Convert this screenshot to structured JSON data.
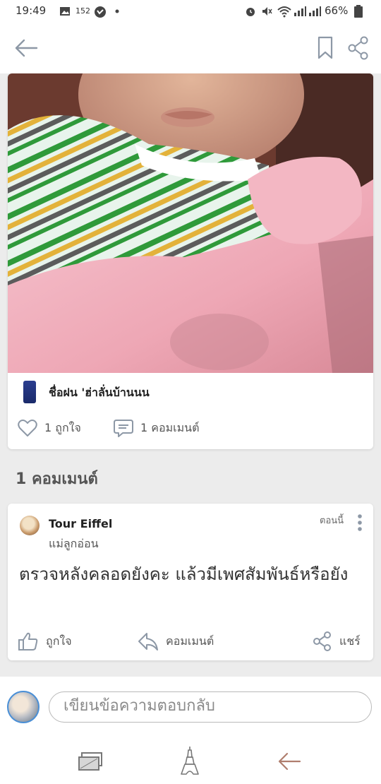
{
  "status_bar": {
    "time": "19:49",
    "notification_count": "152",
    "battery": "66%"
  },
  "post": {
    "author": "ชื่อฝน 'ฮ่าลั่นบ้านนน",
    "likes_label": "1 ถูกใจ",
    "comments_label": "1 คอมเมนต์"
  },
  "comments_section": {
    "title": "1 คอมเมนต์"
  },
  "comment": {
    "author": "Tour Eiffel",
    "group": "แม่ลูกอ่อน",
    "time": "ตอนนี้",
    "text": "ตรวจหลังคลอดยังคะ แล้วมีเพศสัมพันธ์หรือยัง",
    "actions": {
      "like": "ถูกใจ",
      "comment": "คอมเมนต์",
      "share": "แชร์"
    }
  },
  "reply": {
    "placeholder": "เขียนข้อความตอบกลับ"
  },
  "icons": {
    "back": "arrow-left-icon",
    "bookmark": "bookmark-icon",
    "share": "share-icon",
    "heart": "heart-icon",
    "comment": "comment-bubble-icon",
    "thumbs_up": "thumbs-up-icon",
    "reply": "reply-icon",
    "more": "more-vertical-icon",
    "nav_cards": "cards-icon",
    "nav_tower": "eiffel-tower-icon",
    "nav_back": "nav-back-icon"
  },
  "colors": {
    "accent": "#4a8fd6",
    "icon_gray": "#8d98a6"
  }
}
